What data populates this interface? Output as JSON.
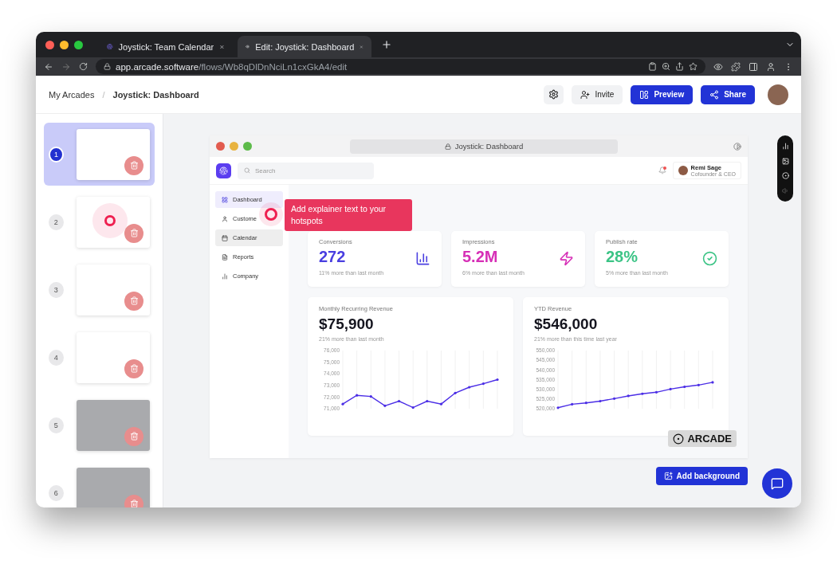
{
  "browser": {
    "tabs": [
      {
        "title": "Joystick: Team Calendar",
        "selected": false
      },
      {
        "title": "Edit: Joystick: Dashboard",
        "selected": true
      }
    ],
    "url_host": "app.arcade.software",
    "url_path": "/flows/Wb8qDlDnNciLn1cxGkA4/edit"
  },
  "header": {
    "breadcrumb": [
      "My Arcades",
      "Joystick: Dashboard"
    ],
    "separator": "/",
    "buttons": [
      {
        "kind": "settings"
      },
      {
        "kind": "invite",
        "label": "Invite"
      },
      {
        "kind": "preview",
        "label": "Preview"
      },
      {
        "kind": "share",
        "label": "Share"
      }
    ]
  },
  "slides": [
    {
      "number": "1",
      "selected": true,
      "kind": "light"
    },
    {
      "number": "2",
      "selected": false,
      "kind": "hotspot"
    },
    {
      "number": "3",
      "selected": false,
      "kind": "light"
    },
    {
      "number": "4",
      "selected": false,
      "kind": "light"
    },
    {
      "number": "5",
      "selected": false,
      "kind": "dark"
    },
    {
      "number": "6",
      "selected": false,
      "kind": "dark"
    }
  ],
  "demo": {
    "title": "Joystick: Dashboard",
    "search": {
      "placeholder": "Search"
    },
    "user": {
      "name": "Remi Sage",
      "role": "Cofounder & CEO"
    },
    "nav": [
      {
        "kind": "grid",
        "label": "Dashboard",
        "selected": true,
        "hovered": false
      },
      {
        "kind": "user",
        "label": "Custome",
        "selected": false,
        "hovered": false
      },
      {
        "kind": "calendar",
        "label": "Calendar",
        "selected": false,
        "hovered": true
      },
      {
        "kind": "reports",
        "label": "Reports",
        "selected": false,
        "hovered": false
      },
      {
        "kind": "company",
        "label": "Company",
        "selected": false,
        "hovered": false
      }
    ],
    "stats": [
      {
        "kind": "bars",
        "label": "Conversions",
        "value": "272",
        "note": "11% more than last month",
        "color": "#4a3fe0"
      },
      {
        "kind": "bolt",
        "label": "Impressions",
        "value": "5.2M",
        "note": "6% more than last month",
        "color": "#d62fb6"
      },
      {
        "kind": "check",
        "label": "Publish rate",
        "value": "28%",
        "note": "5% more than last month",
        "color": "#3cc486"
      }
    ],
    "charts": [
      {
        "title": "Monthly Recurring Revenue",
        "value": "$75,900",
        "note": "21% more than last month",
        "chart_data": {
          "type": "line",
          "grid": true,
          "ylim": [
            71000,
            76000
          ],
          "yticks": [
            {
              "value": 71000,
              "label": "71,000"
            },
            {
              "value": 72000,
              "label": "72,000"
            },
            {
              "value": 73000,
              "label": "73,000"
            },
            {
              "value": 74000,
              "label": "74,000"
            },
            {
              "value": 75000,
              "label": "75,000"
            },
            {
              "value": 76000,
              "label": "76,000"
            }
          ],
          "series": [
            {
              "color": "#4b2ee6",
              "values": [
                71400,
                72150,
                72050,
                71250,
                71650,
                71100,
                71650,
                71400,
                72350,
                72850,
                73150,
                73500
              ]
            }
          ]
        }
      },
      {
        "title": "YTD Revenue",
        "value": "$546,000",
        "note": "21% more than this time last year",
        "chart_data": {
          "type": "line",
          "grid": true,
          "ylim": [
            520000,
            550000
          ],
          "yticks": [
            {
              "value": 520000,
              "label": "520,000"
            },
            {
              "value": 525000,
              "label": "525,000"
            },
            {
              "value": 530000,
              "label": "530,000"
            },
            {
              "value": 535000,
              "label": "535,000"
            },
            {
              "value": 540000,
              "label": "540,000"
            },
            {
              "value": 545000,
              "label": "545,000"
            },
            {
              "value": 550000,
              "label": "550,000"
            }
          ],
          "series": [
            {
              "color": "#4b2ee6",
              "values": [
                520500,
                522300,
                523000,
                523900,
                525200,
                526600,
                527700,
                528500,
                530100,
                531300,
                532200,
                533600
              ]
            }
          ]
        }
      }
    ]
  },
  "tooltip": {
    "text": "Add explainer text to your hotspots"
  },
  "badge": {
    "text": "ARCADE"
  },
  "add_background": {
    "label": "Add background"
  }
}
